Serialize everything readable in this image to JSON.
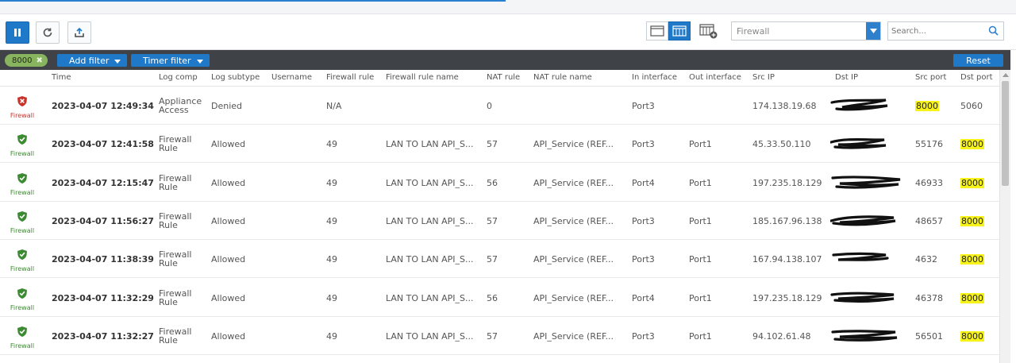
{
  "toolbar": {
    "log_type_select": {
      "value": "Firewall"
    },
    "search": {
      "placeholder": "Search..."
    }
  },
  "filters": {
    "chip": {
      "label": "8000"
    },
    "add_filter": "Add filter",
    "timer_filter": "Timer filter",
    "reset": "Reset"
  },
  "table": {
    "columns": [
      "Time",
      "Log comp",
      "Log subtype",
      "Username",
      "Firewall rule",
      "Firewall rule name",
      "NAT rule",
      "NAT rule name",
      "In interface",
      "Out interface",
      "Src IP",
      "Dst IP",
      "Src port",
      "Dst port"
    ],
    "rows": [
      {
        "status": "denied",
        "type": "Firewall",
        "time": "2023-04-07 12:49:34",
        "log_comp": "Appliance Access",
        "log_subtype": "Denied",
        "username": "",
        "fw_rule": "N/A",
        "fw_rule_name": "",
        "nat_rule": "0",
        "nat_rule_name": "",
        "in_if": "Port3",
        "out_if": "",
        "src_ip": "174.138.19.68",
        "src_port": "8000",
        "dst_port": "5060"
      },
      {
        "status": "allowed",
        "type": "Firewall",
        "time": "2023-04-07 12:41:58",
        "log_comp": "Firewall Rule",
        "log_subtype": "Allowed",
        "username": "",
        "fw_rule": "49",
        "fw_rule_name": "LAN TO LAN API_S...",
        "nat_rule": "57",
        "nat_rule_name": "API_Service (REF...",
        "in_if": "Port3",
        "out_if": "Port1",
        "src_ip": "45.33.50.110",
        "src_port": "55176",
        "dst_port": "8000"
      },
      {
        "status": "allowed",
        "type": "Firewall",
        "time": "2023-04-07 12:15:47",
        "log_comp": "Firewall Rule",
        "log_subtype": "Allowed",
        "username": "",
        "fw_rule": "49",
        "fw_rule_name": "LAN TO LAN API_S...",
        "nat_rule": "56",
        "nat_rule_name": "API_Service (REF...",
        "in_if": "Port4",
        "out_if": "Port1",
        "src_ip": "197.235.18.129",
        "src_port": "46933",
        "dst_port": "8000"
      },
      {
        "status": "allowed",
        "type": "Firewall",
        "time": "2023-04-07 11:56:27",
        "log_comp": "Firewall Rule",
        "log_subtype": "Allowed",
        "username": "",
        "fw_rule": "49",
        "fw_rule_name": "LAN TO LAN API_S...",
        "nat_rule": "57",
        "nat_rule_name": "API_Service (REF...",
        "in_if": "Port3",
        "out_if": "Port1",
        "src_ip": "185.167.96.138",
        "src_port": "48657",
        "dst_port": "8000"
      },
      {
        "status": "allowed",
        "type": "Firewall",
        "time": "2023-04-07 11:38:39",
        "log_comp": "Firewall Rule",
        "log_subtype": "Allowed",
        "username": "",
        "fw_rule": "49",
        "fw_rule_name": "LAN TO LAN API_S...",
        "nat_rule": "57",
        "nat_rule_name": "API_Service (REF...",
        "in_if": "Port3",
        "out_if": "Port1",
        "src_ip": "167.94.138.107",
        "src_port": "4632",
        "dst_port": "8000"
      },
      {
        "status": "allowed",
        "type": "Firewall",
        "time": "2023-04-07 11:32:29",
        "log_comp": "Firewall Rule",
        "log_subtype": "Allowed",
        "username": "",
        "fw_rule": "49",
        "fw_rule_name": "LAN TO LAN API_S...",
        "nat_rule": "56",
        "nat_rule_name": "API_Service (REF...",
        "in_if": "Port4",
        "out_if": "Port1",
        "src_ip": "197.235.18.129",
        "src_port": "46378",
        "dst_port": "8000"
      },
      {
        "status": "allowed",
        "type": "Firewall",
        "time": "2023-04-07 11:32:27",
        "log_comp": "Firewall Rule",
        "log_subtype": "Allowed",
        "username": "",
        "fw_rule": "49",
        "fw_rule_name": "LAN TO LAN API_S...",
        "nat_rule": "57",
        "nat_rule_name": "API_Service (REF...",
        "in_if": "Port3",
        "out_if": "Port1",
        "src_ip": "94.102.61.48",
        "src_port": "56501",
        "dst_port": "8000"
      }
    ],
    "highlight_value": "8000"
  },
  "colors": {
    "accent": "#1f78c8",
    "filter_bar": "#3f4247",
    "chip": "#89b45f",
    "denied": "#c8342c",
    "allowed": "#3c8a32",
    "highlight": "#f6f21a"
  }
}
